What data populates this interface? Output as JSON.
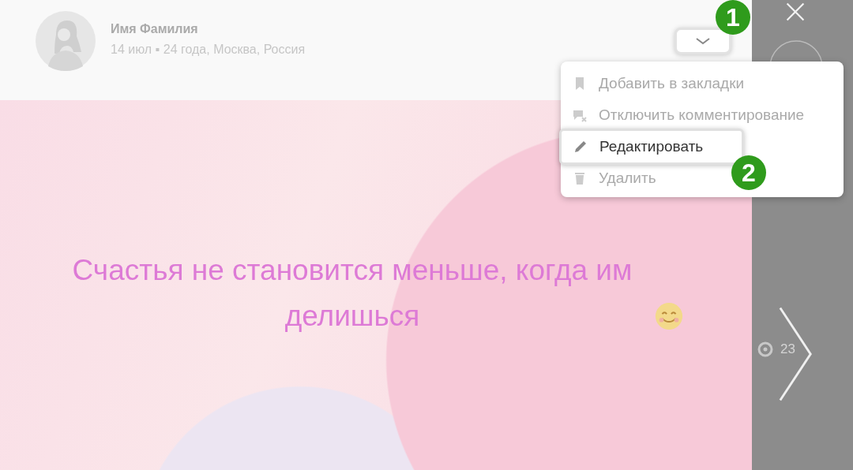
{
  "author": {
    "name": "Имя Фамилия",
    "meta": "14 июл ▪ 24 года, Москва, Россия"
  },
  "post": {
    "text": "Счастья не становится меньше, когда им делишься"
  },
  "menu": {
    "items": [
      {
        "label": "Добавить в закладки",
        "kind": "bookmark",
        "selected": false
      },
      {
        "label": "Отключить комментирование",
        "kind": "comments-off",
        "selected": false
      },
      {
        "label": "Редактировать",
        "kind": "edit",
        "selected": true
      },
      {
        "label": "Удалить",
        "kind": "delete",
        "selected": false
      }
    ]
  },
  "markers": [
    {
      "label": "1",
      "kind": "dropdown"
    },
    {
      "label": "2",
      "kind": "item"
    }
  ],
  "side": {
    "views": "23"
  }
}
